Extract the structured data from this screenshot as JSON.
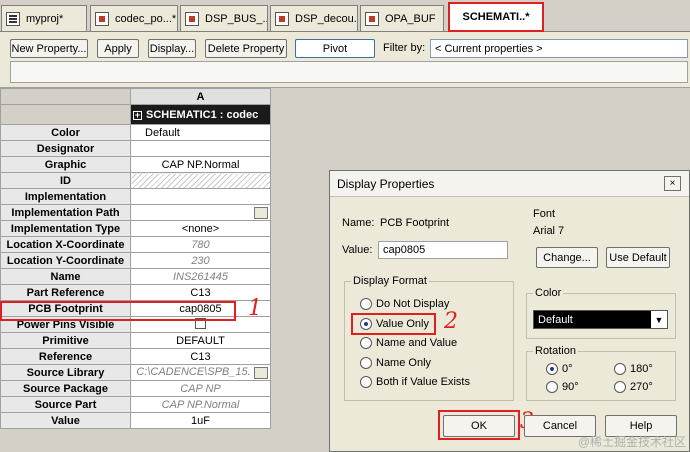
{
  "tabs": [
    {
      "label": "myproj*",
      "icon": "project-icon"
    },
    {
      "label": "codec_po...*",
      "icon": "page-icon"
    },
    {
      "label": "DSP_BUS_...",
      "icon": "page-icon"
    },
    {
      "label": "DSP_decou...",
      "icon": "page-icon"
    },
    {
      "label": "OPA_BUF",
      "icon": "page-icon"
    },
    {
      "label": "SCHEMATI..*",
      "icon": "",
      "active": true
    }
  ],
  "toolbar": {
    "new_property": "New Property...",
    "apply": "Apply",
    "display": "Display...",
    "delete_property": "Delete Property",
    "pivot": "Pivot",
    "filter_label": "Filter by:",
    "filter_value": "< Current properties >"
  },
  "grid": {
    "column_letter": "A",
    "column_header": "SCHEMATIC1 : codec",
    "rows": [
      {
        "name": "Color",
        "value": "Default",
        "style": "left"
      },
      {
        "name": "Designator",
        "value": "",
        "style": ""
      },
      {
        "name": "Graphic",
        "value": "CAP NP.Normal",
        "style": ""
      },
      {
        "name": "ID",
        "value": "",
        "style": "hatch"
      },
      {
        "name": "Implementation",
        "value": "",
        "style": ""
      },
      {
        "name": "Implementation Path",
        "value": "",
        "style": "browse"
      },
      {
        "name": "Implementation Type",
        "value": "<none>",
        "style": ""
      },
      {
        "name": "Location X-Coordinate",
        "value": "780",
        "style": "gray"
      },
      {
        "name": "Location Y-Coordinate",
        "value": "230",
        "style": "gray"
      },
      {
        "name": "Name",
        "value": "INS261445",
        "style": "gray"
      },
      {
        "name": "Part Reference",
        "value": "C13",
        "style": ""
      },
      {
        "name": "PCB Footprint",
        "value": "cap0805",
        "style": ""
      },
      {
        "name": "Power Pins Visible",
        "value": "",
        "style": "check"
      },
      {
        "name": "Primitive",
        "value": "DEFAULT",
        "style": ""
      },
      {
        "name": "Reference",
        "value": "C13",
        "style": ""
      },
      {
        "name": "Source Library",
        "value": "C:\\CADENCE\\SPB_15.",
        "style": "gray-browse"
      },
      {
        "name": "Source Package",
        "value": "CAP NP",
        "style": "gray"
      },
      {
        "name": "Source Part",
        "value": "CAP NP.Normal",
        "style": "gray"
      },
      {
        "name": "Value",
        "value": "1uF",
        "style": ""
      }
    ]
  },
  "annotations": {
    "a1": "1",
    "a2": "2",
    "a3": "3"
  },
  "dialog": {
    "title": "Display Properties",
    "close": "×",
    "name_label": "Name:",
    "name_value": "PCB Footprint",
    "value_label": "Value:",
    "value_value": "cap0805",
    "font_title": "Font",
    "font_value": "Arial 7",
    "change_button": "Change...",
    "use_default_button": "Use Default",
    "display_format_title": "Display Format",
    "formats": [
      "Do Not Display",
      "Value Only",
      "Name and Value",
      "Name Only",
      "Both if Value Exists"
    ],
    "selected_format": "Value Only",
    "color_title": "Color",
    "color_value": "Default",
    "rotation_title": "Rotation",
    "rotations": [
      "0°",
      "180°",
      "90°",
      "270°"
    ],
    "selected_rotation": "0°",
    "ok": "OK",
    "cancel": "Cancel",
    "help": "Help"
  },
  "watermark": "@稀土掘金技术社区"
}
